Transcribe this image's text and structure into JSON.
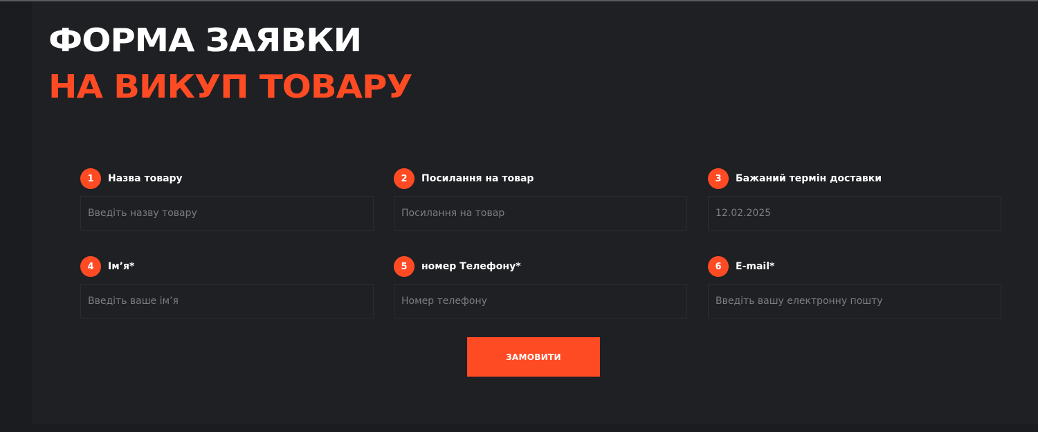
{
  "heading": {
    "line1": "ФОРМА ЗАЯВКИ",
    "line2": "НА ВИКУП ТОВАРУ"
  },
  "colors": {
    "accent": "#ff4b24",
    "background": "#1f2024",
    "outer_background": "#1b1c1f",
    "text": "#ffffff",
    "placeholder": "#7c7d82"
  },
  "fields": [
    {
      "number": "1",
      "label": "Назва товару",
      "placeholder": "Введіть назву товару",
      "value": ""
    },
    {
      "number": "2",
      "label": "Посилання на товар",
      "placeholder": "Посилання на товар",
      "value": ""
    },
    {
      "number": "3",
      "label": "Бажаний термін доставки",
      "placeholder": "12.02.2025",
      "value": ""
    },
    {
      "number": "4",
      "label": "Ім’я*",
      "placeholder": "Введіть ваше ім’я",
      "value": ""
    },
    {
      "number": "5",
      "label": "номер Телефону*",
      "placeholder": "Номер телефону",
      "value": ""
    },
    {
      "number": "6",
      "label": "E-mail*",
      "placeholder": "Введіть вашу електронну пошту",
      "value": ""
    }
  ],
  "submit": {
    "label": "ЗАМОВИТИ"
  }
}
